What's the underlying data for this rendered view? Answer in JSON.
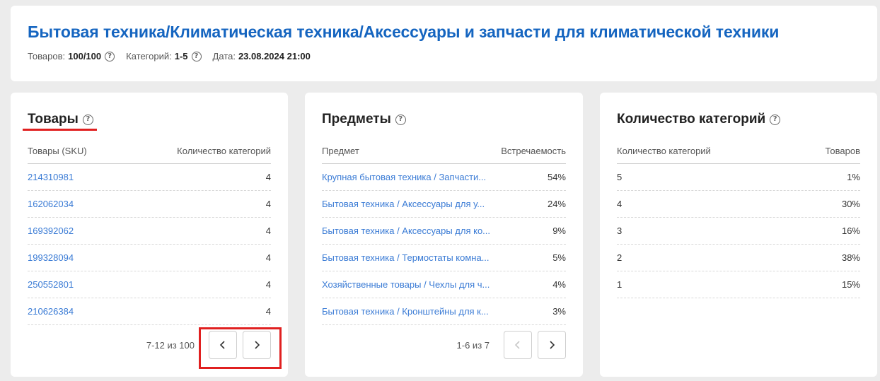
{
  "header": {
    "title": "Бытовая техника/Климатическая техника/Аксессуары и запчасти для климатической техники",
    "meta": [
      {
        "label": "Товаров:",
        "value": "100/100",
        "help": true
      },
      {
        "label": "Категорий:",
        "value": "1-5",
        "help": true
      },
      {
        "label": "Дата:",
        "value": "23.08.2024 21:00",
        "help": false
      }
    ]
  },
  "products": {
    "title": "Товары",
    "col_left": "Товары (SKU)",
    "col_right": "Количество категорий",
    "rows": [
      {
        "sku": "214310981",
        "count": "4"
      },
      {
        "sku": "162062034",
        "count": "4"
      },
      {
        "sku": "169392062",
        "count": "4"
      },
      {
        "sku": "199328094",
        "count": "4"
      },
      {
        "sku": "250552801",
        "count": "4"
      },
      {
        "sku": "210626384",
        "count": "4"
      }
    ],
    "pager_info": "7-12 из 100"
  },
  "subjects": {
    "title": "Предметы",
    "col_left": "Предмет",
    "col_right": "Встречаемость",
    "rows": [
      {
        "name": "Крупная бытовая техника / Запчасти...",
        "pct": "54%"
      },
      {
        "name": "Бытовая техника / Аксессуары для у...",
        "pct": "24%"
      },
      {
        "name": "Бытовая техника / Аксессуары для ко...",
        "pct": "9%"
      },
      {
        "name": "Бытовая техника / Термостаты комна...",
        "pct": "5%"
      },
      {
        "name": "Хозяйственные товары / Чехлы для ч...",
        "pct": "4%"
      },
      {
        "name": "Бытовая техника / Кронштейны для к...",
        "pct": "3%"
      }
    ],
    "pager_info": "1-6 из 7"
  },
  "categories": {
    "title": "Количество категорий",
    "col_left": "Количество категорий",
    "col_right": "Товаров",
    "rows": [
      {
        "count": "5",
        "pct": "1%"
      },
      {
        "count": "4",
        "pct": "30%"
      },
      {
        "count": "3",
        "pct": "16%"
      },
      {
        "count": "2",
        "pct": "38%"
      },
      {
        "count": "1",
        "pct": "15%"
      }
    ]
  }
}
